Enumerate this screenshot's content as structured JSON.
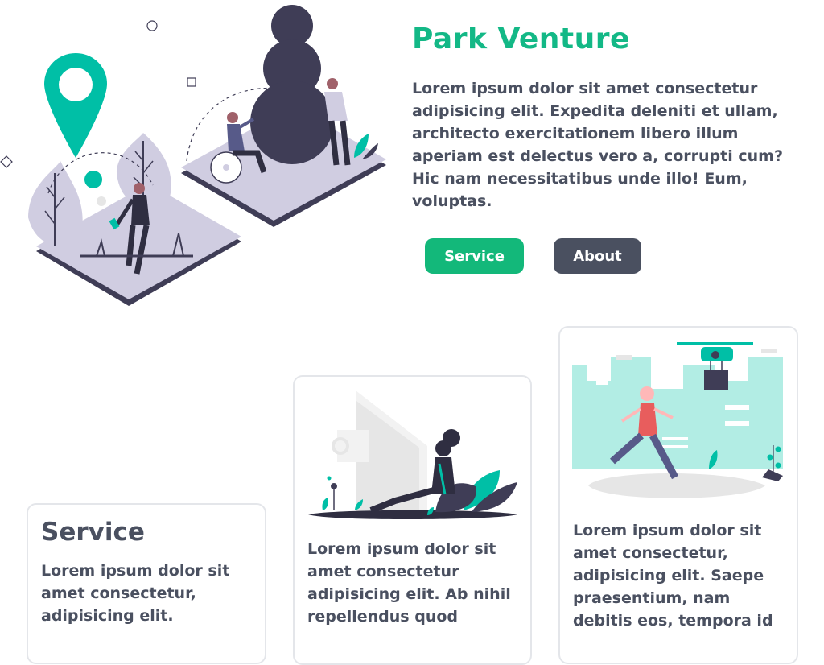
{
  "hero": {
    "title": "Park Venture",
    "intro": "Lorem ipsum dolor sit amet consectetur adipisicing elit. Expedita deleniti et ullam, architecto exercitationem libero illum aperiam est delectus vero a, corrupti cum? Hic nam necessitatibus unde illo! Eum, voluptas.",
    "buttons": {
      "service_label": "Service",
      "about_label": "About"
    }
  },
  "cards": [
    {
      "title": "Service",
      "text": "Lorem ipsum dolor sit amet consectetur, adipisicing elit."
    },
    {
      "text": "Lorem ipsum dolor sit amet consectetur adipisicing elit. Ab nihil repellendus quod"
    },
    {
      "text": "Lorem ipsum dolor sit amet consectetur, adipisicing elit. Saepe praesentium, nam debitis eos, tempora id"
    }
  ],
  "colors": {
    "accent": "#13b886",
    "button_primary": "#13b87a",
    "button_secondary": "#4a5060",
    "text": "#4a5060",
    "illustration_dark": "#3f3d56",
    "illustration_light": "#d0cde1"
  }
}
